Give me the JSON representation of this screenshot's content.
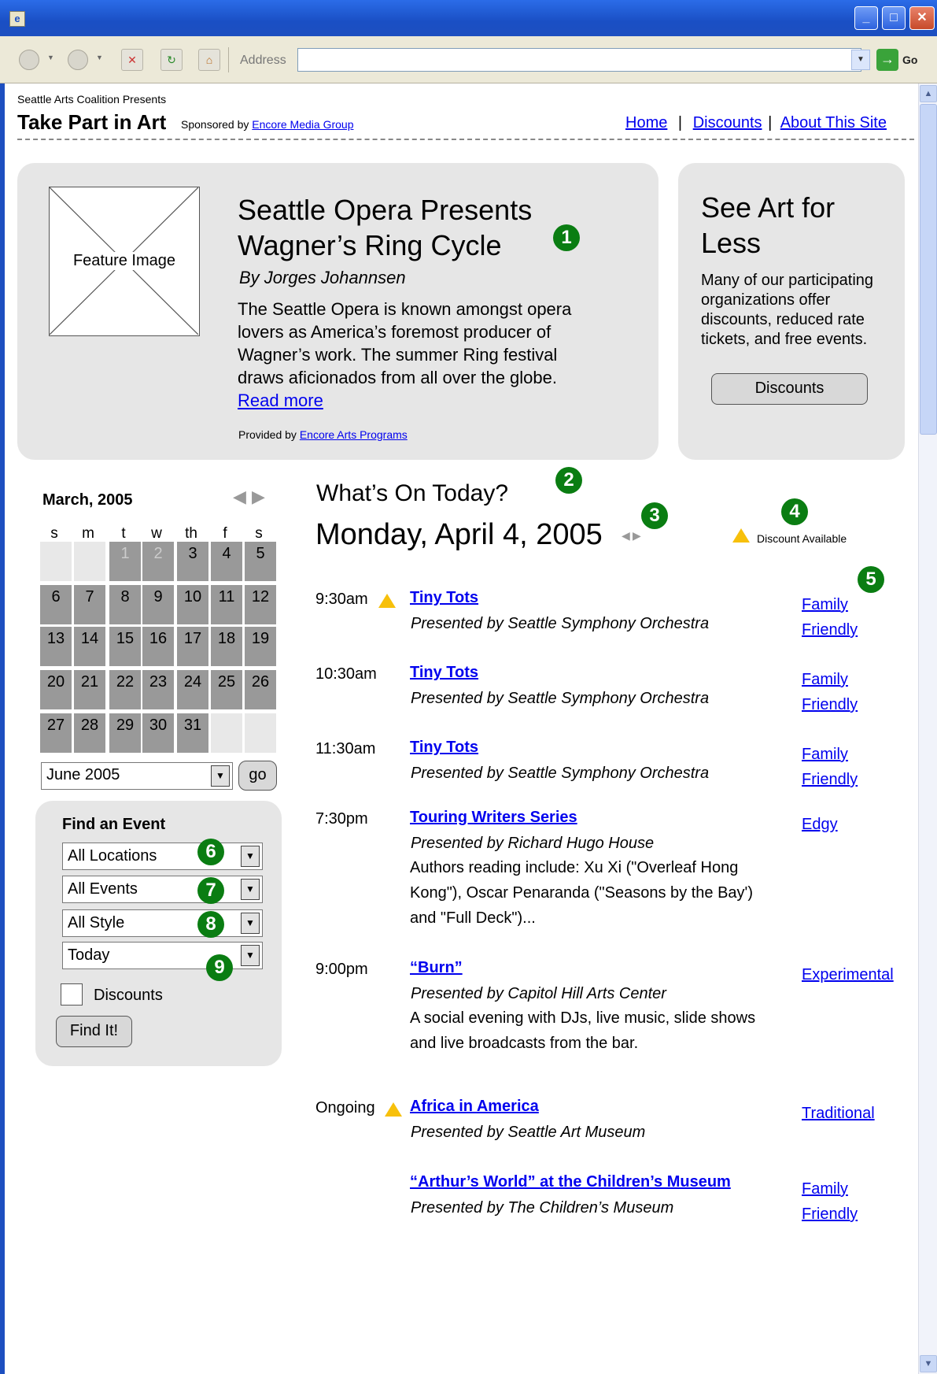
{
  "browser": {
    "address_label": "Address",
    "address_value": "",
    "go_label": "Go"
  },
  "header": {
    "presenter": "Seattle Arts Coalition Presents",
    "site_title": "Take Part in Art",
    "sponsored_prefix": "Sponsored by",
    "sponsor_link": "Encore Media Group",
    "nav": [
      "Home",
      "Discounts",
      "About This Site"
    ],
    "nav_sep": "|"
  },
  "feature": {
    "image_label": "Feature Image",
    "title_line1": "Seattle Opera Presents",
    "title_line2": "Wagner’s Ring Cycle",
    "byline": "By Jorges Johannsen",
    "body": [
      "The Seattle Opera is known amongst opera",
      "lovers as America’s foremost producer of",
      "Wagner’s work. The summer Ring festival",
      "draws aficionados from all over the globe."
    ],
    "read_more": "Read more",
    "provided_prefix": "Provided by",
    "provided_link": "Encore Arts Programs"
  },
  "discount_panel": {
    "title_line1": "See Art for",
    "title_line2": "Less",
    "body": [
      "Many of our participating",
      "organizations offer",
      "discounts, reduced rate",
      "tickets, and free events."
    ],
    "button": "Discounts"
  },
  "annotations": [
    "1",
    "2",
    "3",
    "4",
    "5",
    "6",
    "7",
    "8",
    "9"
  ],
  "calendar": {
    "month": "March, 2005",
    "dow": [
      "s",
      "m",
      "t",
      "w",
      "th",
      "f",
      "s"
    ],
    "rows": [
      [
        "",
        "",
        "1",
        "2",
        "3",
        "4",
        "5"
      ],
      [
        "6",
        "7",
        "8",
        "9",
        "10",
        "11",
        "12"
      ],
      [
        "13",
        "14",
        "15",
        "16",
        "17",
        "18",
        "19"
      ],
      [
        "20",
        "21",
        "22",
        "23",
        "24",
        "25",
        "26"
      ],
      [
        "27",
        "28",
        "29",
        "30",
        "31",
        "",
        ""
      ]
    ],
    "month_select": "June 2005",
    "go_button": "go"
  },
  "find_event": {
    "title": "Find an Event",
    "location": "All Locations",
    "events": "All Events",
    "style": "All Style",
    "when": "Today",
    "discounts_label": "Discounts",
    "button": "Find It!"
  },
  "today": {
    "heading": "What’s On Today?",
    "date": "Monday, April 4, 2005",
    "legend": "Discount Available"
  },
  "events": [
    {
      "time": "9:30am",
      "title": "Tiny Tots",
      "by": "Presented by Seattle Symphony Orchestra",
      "desc": [],
      "tag": [
        "Family",
        "Friendly"
      ],
      "discount": true
    },
    {
      "time": "10:30am",
      "title": "Tiny Tots",
      "by": "Presented by Seattle Symphony Orchestra",
      "desc": [],
      "tag": [
        "Family",
        "Friendly"
      ],
      "discount": false
    },
    {
      "time": "11:30am",
      "title": "Tiny Tots",
      "by": "Presented by Seattle Symphony Orchestra",
      "desc": [],
      "tag": [
        "Family",
        "Friendly"
      ],
      "discount": false
    },
    {
      "time": "7:30pm",
      "title": "Touring Writers Series",
      "by": "Presented by Richard Hugo House",
      "desc": [
        "Authors reading include: Xu Xi (\"Overleaf Hong",
        "Kong\"), Oscar Penaranda (\"Seasons by the Bay')",
        "and \"Full Deck\")..."
      ],
      "tag": [
        "Edgy"
      ],
      "discount": false
    },
    {
      "time": "9:00pm",
      "title": "“Burn”",
      "by": "Presented by Capitol Hill Arts Center",
      "desc": [
        "A social evening with DJs, live music, slide shows",
        "and live broadcasts from the bar."
      ],
      "tag": [
        "Experimental"
      ],
      "discount": false
    },
    {
      "time": "Ongoing",
      "title": "Africa in America",
      "by": "Presented by Seattle Art Museum",
      "desc": [],
      "tag": [
        "Traditional"
      ],
      "discount": true
    },
    {
      "time": "",
      "title": "“Arthur’s World” at the Children’s Museum",
      "by": "Presented by The Children’s Museum",
      "desc": [],
      "tag": [
        "Family",
        "Friendly"
      ],
      "discount": false
    }
  ]
}
